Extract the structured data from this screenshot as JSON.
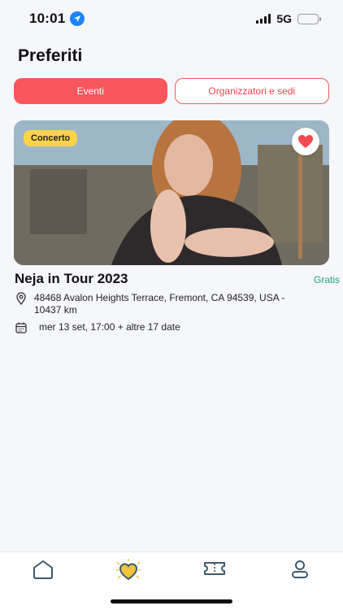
{
  "status": {
    "time": "10:01",
    "network": "5G",
    "icons": [
      "location-arrow-icon",
      "signal-icon",
      "battery-charging-icon"
    ]
  },
  "page": {
    "title": "Preferiti"
  },
  "tabs": [
    {
      "label": "Eventi",
      "active": true
    },
    {
      "label": "Organizzatori e sedi",
      "active": false
    }
  ],
  "event": {
    "badge": "Concerto",
    "title": "Neja in Tour 2023",
    "price": "Gratis",
    "address": "48468 Avalon Heights Terrace, Fremont, CA 94539, USA - 10437 km",
    "date": "mer 13 set, 17:00 + altre 17 date",
    "favorite": true
  },
  "nav": {
    "items": [
      {
        "icon": "home-icon",
        "active": false
      },
      {
        "icon": "heart-favorites-icon",
        "active": true
      },
      {
        "icon": "ticket-icon",
        "active": false
      },
      {
        "icon": "profile-icon",
        "active": false
      }
    ]
  },
  "colors": {
    "accent": "#f7575d",
    "badge": "#fed34a",
    "price": "#21a47c",
    "nav_icon": "#3d5a6c",
    "favorite_heart": "#f2c43a"
  }
}
